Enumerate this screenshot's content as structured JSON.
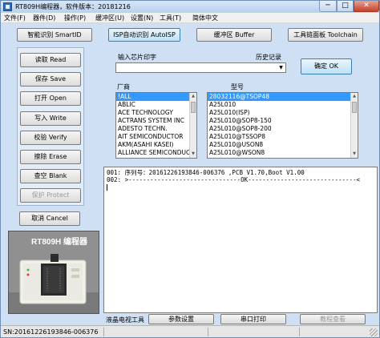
{
  "window": {
    "title": "RT809H编程器，软件版本：20181216"
  },
  "titlebar_buttons": {
    "minimize": "─",
    "maximize": "□",
    "close": "✕"
  },
  "menu": [
    "文件(F)",
    "器件(D)",
    "操作(P)",
    "缓冲区(U)",
    "设置(N)",
    "工具(T)",
    "简体中文"
  ],
  "toolbar": {
    "smart_id": "智能识别 SmartID",
    "isp_auto": "ISP自动识别 AutoISP",
    "buffer": "缓冲区 Buffer",
    "toolchain": "工具链面板 Toolchain"
  },
  "side_buttons": {
    "read": "读取 Read",
    "save": "保存 Save",
    "open": "打开 Open",
    "write": "写入 Write",
    "verify": "校验 Verify",
    "erase": "擦除 Erase",
    "blank": "查空 Blank",
    "protect": "保护 Protect",
    "cancel": "取消 Cancel"
  },
  "chip": {
    "input_label": "输入芯片印字",
    "history_label": "历史记录",
    "input_value": "",
    "ok_label": "确定 OK",
    "manufacturer_label": "厂商",
    "model_label": "型号",
    "manufacturers": [
      "!ALL",
      "ABLIC",
      "ACE TECHNOLOGY",
      "ACTRANS SYSTEM INC",
      "ADESTO TECHN.",
      "AIT SEMICONDUCTOR",
      "AKM(ASAHI KASEI)",
      "ALLIANCE SEMICONDUCTOR"
    ],
    "models": [
      "28032116@TSOP48",
      "A25L010",
      "A25L010(ISP)",
      "A25L010@SOP8-150",
      "A25L010@SOP8-200",
      "A25L010@TSSOP8",
      "A25L010@USON8",
      "A25L010@WSON8"
    ]
  },
  "log": {
    "lines": [
      "001: 序列号：20161226193846-006376 ,PCB V1.70,Boot V1.00",
      "002: >-------------------------------OK------------------------------<"
    ]
  },
  "product": {
    "brand_label": "RT809H 编程器"
  },
  "bottom": {
    "lcd_label": "液晶电视工具",
    "params": "参数设置",
    "serial": "串口打印",
    "tutorial": "教程查看"
  },
  "status": {
    "sn": "SN:20161226193846-006376"
  }
}
